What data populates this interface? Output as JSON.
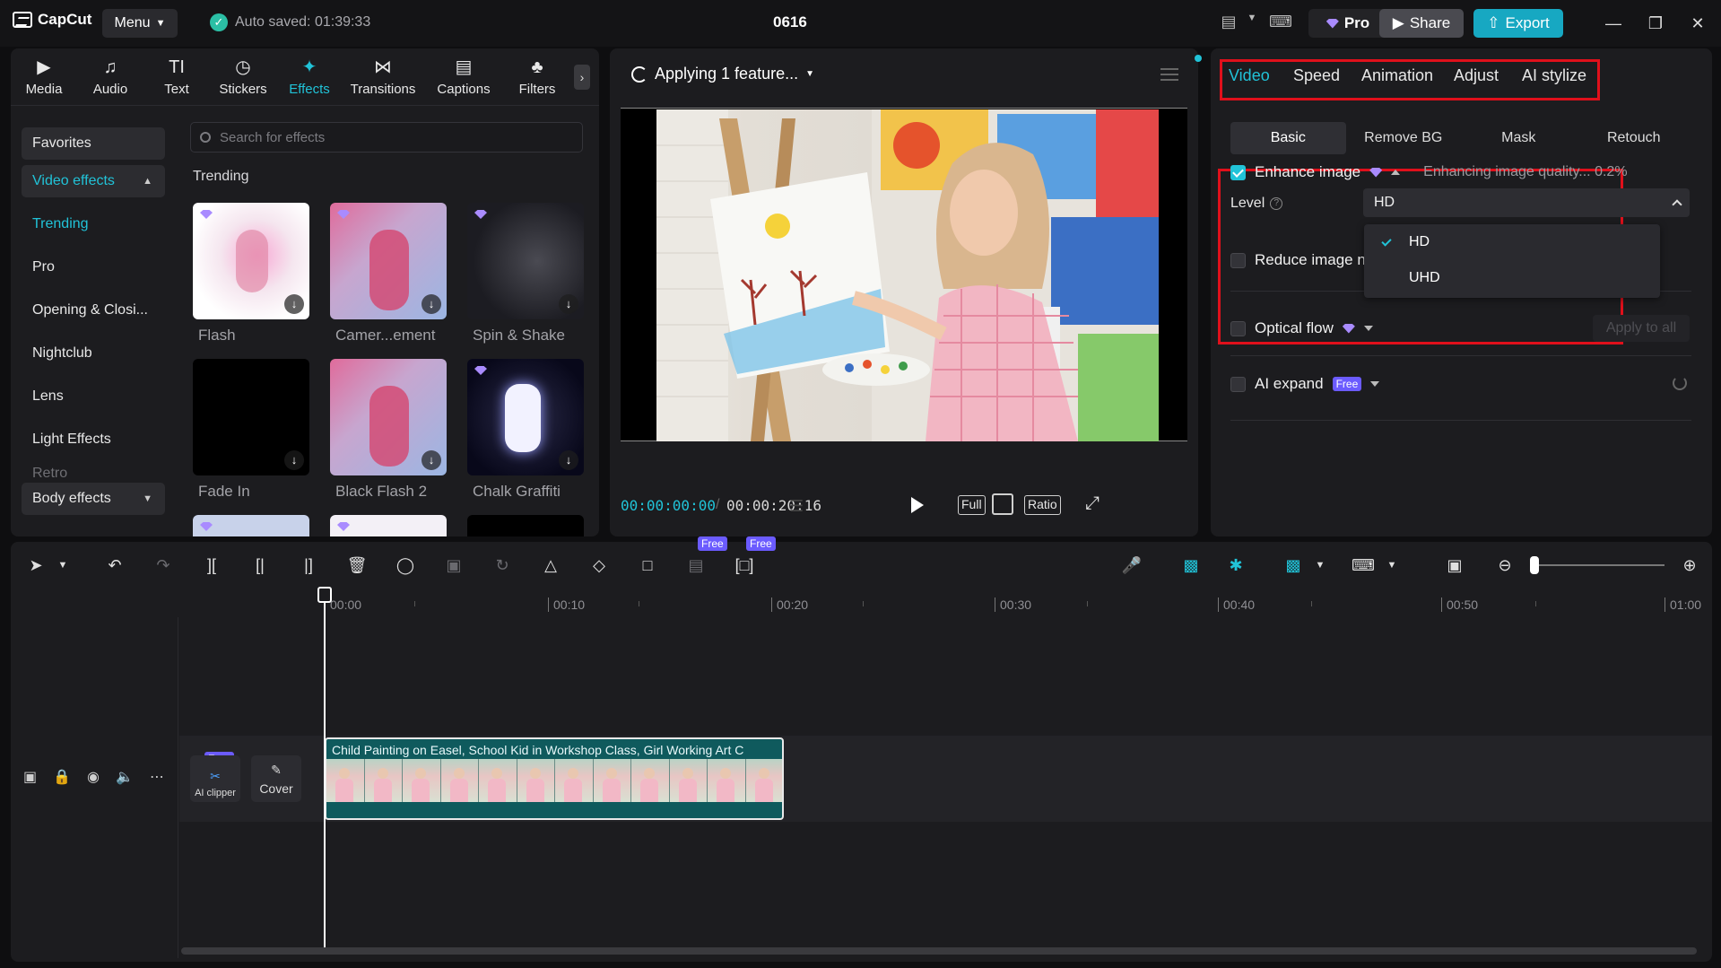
{
  "app": {
    "name": "CapCut",
    "menu_label": "Menu",
    "autosave": "Auto saved: 01:39:33",
    "project_title": "0616",
    "pro_label": "Pro",
    "share_label": "Share",
    "export_label": "Export"
  },
  "colors": {
    "accent": "#21c3d8",
    "highlight": "#e0101b",
    "pro_gem": "#a98bff",
    "free_badge": "#6b5bff"
  },
  "tool_tabs": [
    {
      "label": "Media",
      "icon": "media-icon"
    },
    {
      "label": "Audio",
      "icon": "audio-icon"
    },
    {
      "label": "Text",
      "icon": "text-icon"
    },
    {
      "label": "Stickers",
      "icon": "stickers-icon"
    },
    {
      "label": "Effects",
      "icon": "effects-icon",
      "active": true
    },
    {
      "label": "Transitions",
      "icon": "transitions-icon"
    },
    {
      "label": "Captions",
      "icon": "captions-icon"
    },
    {
      "label": "Filters",
      "icon": "filters-icon"
    }
  ],
  "sidenav": {
    "favorites": "Favorites",
    "video_effects": "Video effects",
    "items": [
      "Trending",
      "Pro",
      "Opening & Closi...",
      "Nightclub",
      "Lens",
      "Light Effects"
    ],
    "retro": "Retro",
    "body_effects": "Body effects"
  },
  "search": {
    "placeholder": "Search for effects"
  },
  "trending_label": "Trending",
  "effects": [
    {
      "name": "Flash"
    },
    {
      "name": "Camer...ement"
    },
    {
      "name": "Spin & Shake"
    },
    {
      "name": "Fade In"
    },
    {
      "name": "Black Flash 2"
    },
    {
      "name": "Chalk Graffiti"
    }
  ],
  "player": {
    "status": "Applying 1 feature...",
    "current_time": "00:00:00:00",
    "total_time": "00:00:20:16",
    "full_label": "Full",
    "ratio_label": "Ratio"
  },
  "inspector": {
    "tabs": [
      "Video",
      "Speed",
      "Animation",
      "Adjust",
      "AI stylize"
    ],
    "active_tab": "Video",
    "subtabs": [
      "Basic",
      "Remove BG",
      "Mask",
      "Retouch"
    ],
    "active_subtab": "Basic",
    "enhance_label": "Enhance image",
    "enhance_checked": true,
    "enhance_status": "Enhancing image quality... 0.2%",
    "level_label": "Level",
    "level_value": "HD",
    "level_options": [
      "HD",
      "UHD"
    ],
    "reduce_noise_label": "Reduce image noise",
    "optical_flow_label": "Optical flow",
    "apply_all_label": "Apply to all",
    "ai_expand_label": "AI expand",
    "free_label": "Free"
  },
  "timeline": {
    "ruler": [
      "00:00",
      "00:10",
      "00:20",
      "00:30",
      "00:40",
      "00:50",
      "01:00"
    ],
    "clip_title": "Child Painting on Easel, School Kid in Workshop Class, Girl Working Art C",
    "ai_clipper_label": "AI clipper",
    "cover_label": "Cover",
    "free_label": "Free"
  }
}
